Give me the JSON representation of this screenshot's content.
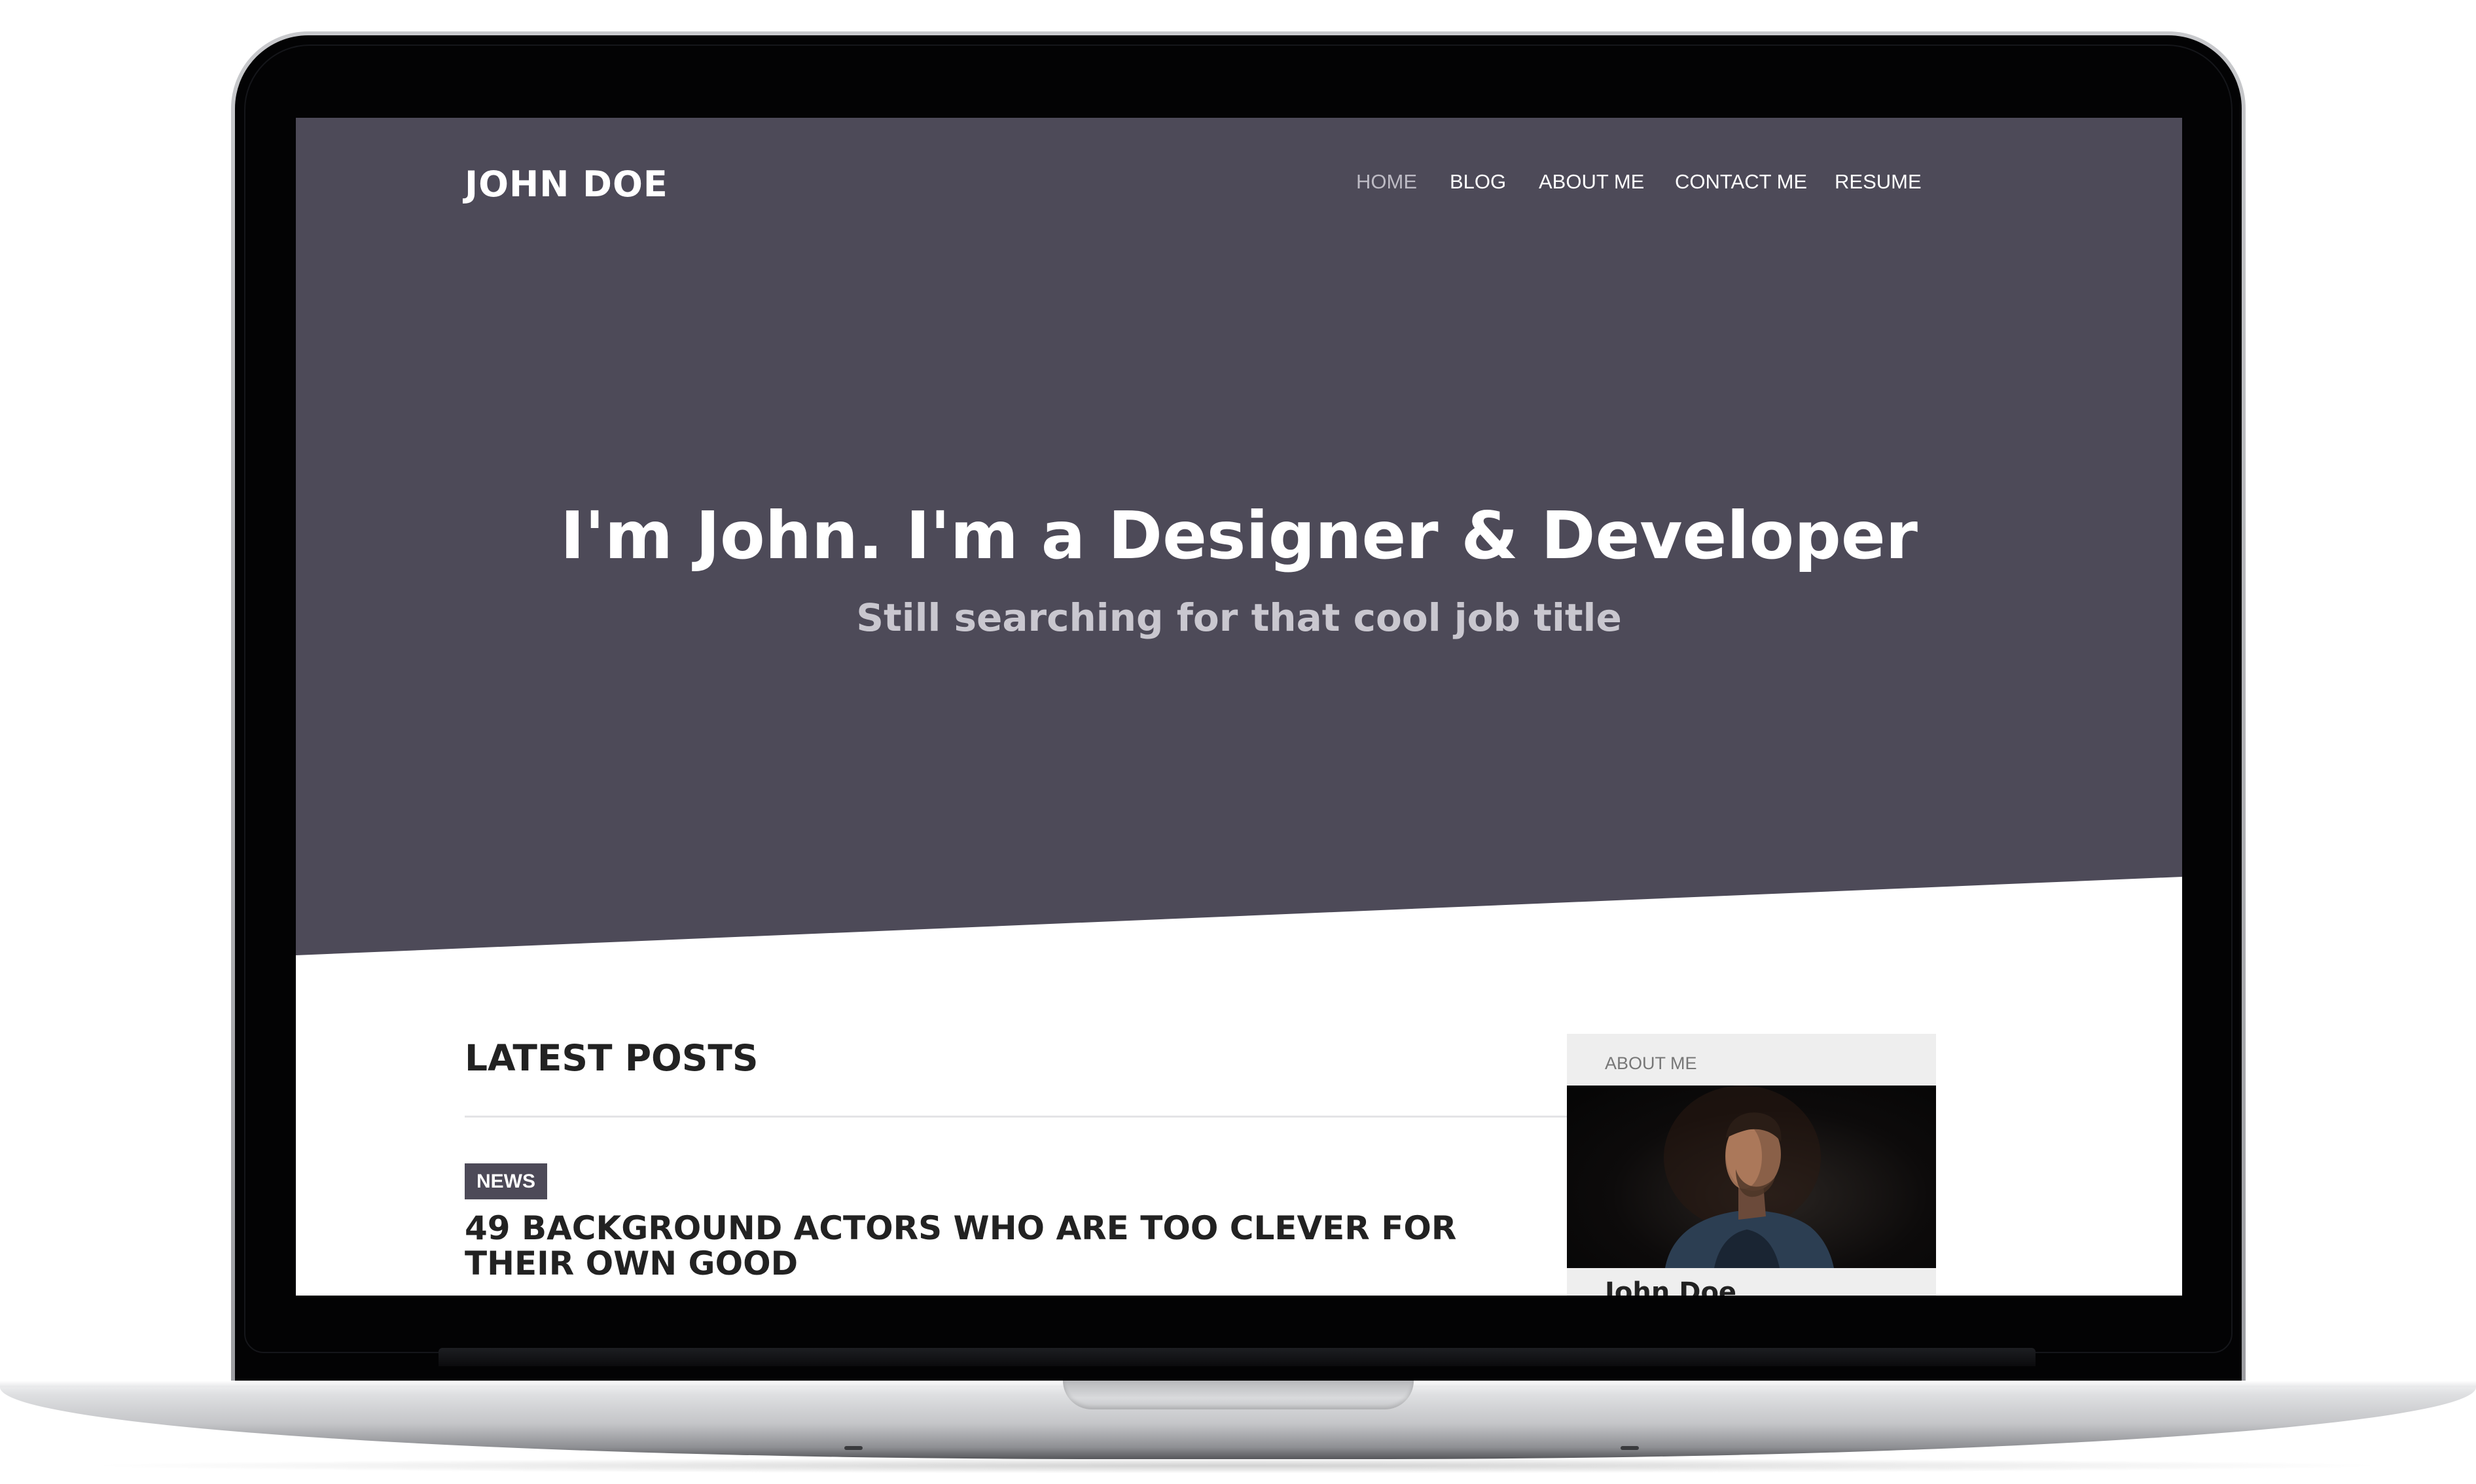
{
  "brand": "JOHN DOE",
  "nav": {
    "items": [
      {
        "label": "HOME",
        "active": true
      },
      {
        "label": "BLOG",
        "active": false
      },
      {
        "label": "ABOUT ME",
        "active": false
      },
      {
        "label": "CONTACT ME",
        "active": false
      },
      {
        "label": "RESUME",
        "active": false
      }
    ]
  },
  "hero": {
    "title": "I'm John. I'm a Designer & Developer",
    "subtitle": "Still searching for that cool job title"
  },
  "posts": {
    "heading": "LATEST POSTS",
    "items": [
      {
        "tag": "NEWS",
        "title": "49 BACKGROUND ACTORS WHO ARE TOO CLEVER FOR THEIR OWN GOOD"
      }
    ]
  },
  "sidebar": {
    "label": "ABOUT ME",
    "name": "John Doe"
  },
  "colors": {
    "hero_background": "#4d4a58",
    "tag_background": "#4d4a58",
    "sidebar_background": "#eeeeee",
    "nav_active": "#bdbbc4"
  }
}
